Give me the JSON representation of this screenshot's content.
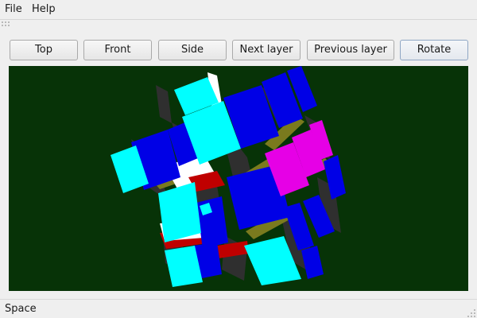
{
  "menu": {
    "file": "File",
    "help": "Help"
  },
  "toolbar": {
    "buttons": [
      {
        "id": "top",
        "label": "Top"
      },
      {
        "id": "front",
        "label": "Front"
      },
      {
        "id": "side",
        "label": "Side"
      },
      {
        "id": "next_layer",
        "label": "Next layer"
      },
      {
        "id": "previous_layer",
        "label": "Previous layer"
      },
      {
        "id": "rotate",
        "label": "Rotate"
      }
    ]
  },
  "viewport": {
    "background": "#073307",
    "cube_colors": {
      "cyan": "#00ffff",
      "blue": "#0000e6",
      "magenta": "#e600e6",
      "white": "#ffffff",
      "red": "#c00000",
      "olive": "#7a7a1e",
      "edge": "#2f2f2f"
    }
  },
  "status": {
    "text": "Space"
  }
}
